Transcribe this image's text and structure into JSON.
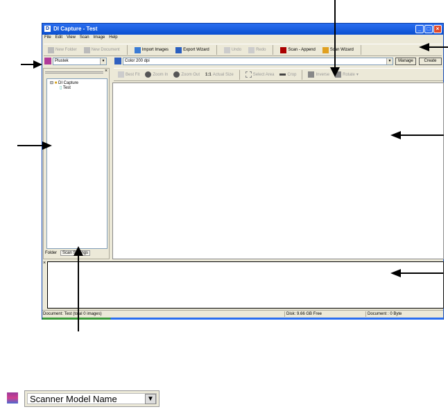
{
  "window": {
    "title": "DI Capture - Test"
  },
  "menu": [
    "File",
    "Edit",
    "View",
    "Scan",
    "Image",
    "Help"
  ],
  "toolbar": {
    "new_folder": "New Folder",
    "new_document": "New Document",
    "import_images": "Import Images",
    "export_wizard": "Export Wizard",
    "undo": "Undo",
    "redo": "Redo",
    "scan_append": "Scan - Append",
    "scan_wizard": "Scan Wizard"
  },
  "scanner_row": {
    "scanner": "Plustek",
    "profile": "Color 200 dpi",
    "manage": "Manage",
    "create": "Create"
  },
  "image_toolbar": {
    "best_fit": "Best Fit",
    "zoom_in": "Zoom In",
    "zoom_out": "Zoom Out",
    "actual_size": "Actual Size",
    "select_area": "Select Area",
    "crop": "Crop",
    "inverse": "Inverse",
    "rotate": "Rotate"
  },
  "tree": {
    "root": "DI Capture",
    "child": "Test"
  },
  "tabs": {
    "folder": "Folder",
    "scan_settings": "Scan Settings"
  },
  "status": {
    "document": "Document: Test (total 0 images)",
    "disk": "Disk: 9.66 GB Free",
    "size": "Document : 0 Byte"
  },
  "callout": {
    "scanner_model": "Scanner Model Name"
  }
}
